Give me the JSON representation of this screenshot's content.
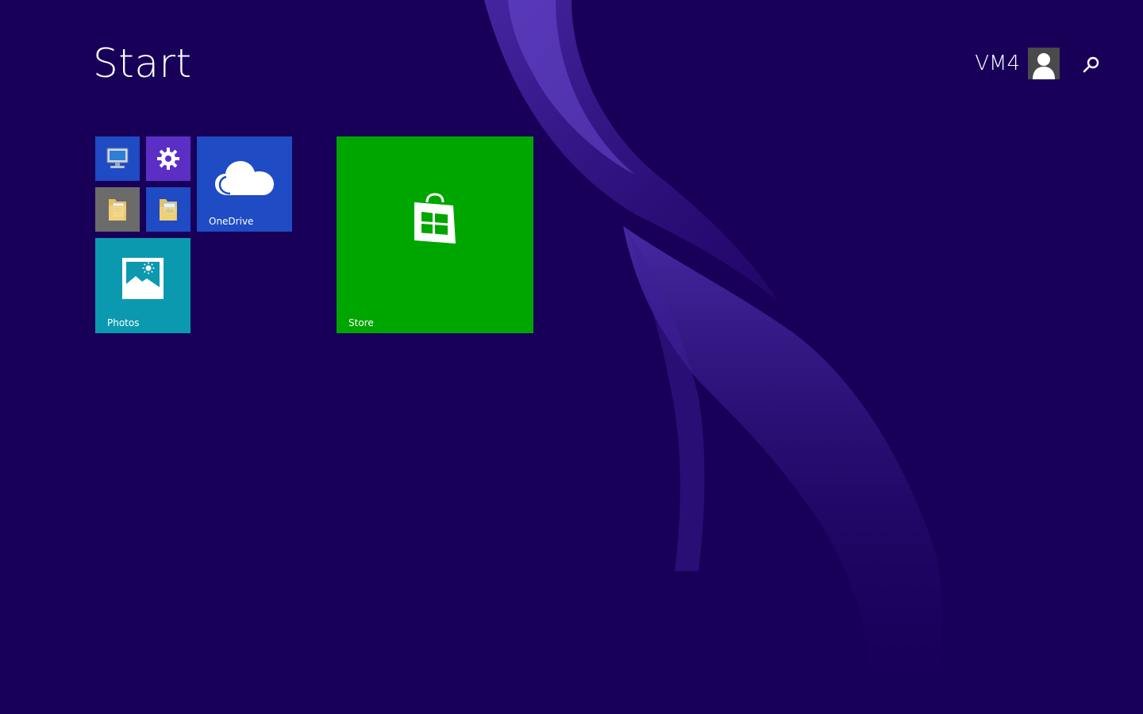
{
  "screen": {
    "title": "Start",
    "background_color": "#180059",
    "accent_swirl_color": "#5a3bb5"
  },
  "user": {
    "name": "VM4",
    "avatar_icon": "user-silhouette-icon"
  },
  "search": {
    "icon": "search-icon"
  },
  "tiles": [
    {
      "id": "this-pc",
      "label": "",
      "icon": "computer-icon",
      "color": "#1f4bc4"
    },
    {
      "id": "pc-settings",
      "label": "",
      "icon": "gear-icon",
      "color": "#5b2fc5"
    },
    {
      "id": "documents",
      "label": "",
      "icon": "documents-folder-icon",
      "color": "#6b6b6b"
    },
    {
      "id": "pictures",
      "label": "",
      "icon": "pictures-folder-icon",
      "color": "#1f4bc4"
    },
    {
      "id": "onedrive",
      "label": "OneDrive",
      "icon": "cloud-icon",
      "color": "#1f4bc4"
    },
    {
      "id": "photos",
      "label": "Photos",
      "icon": "photo-icon",
      "color": "#0b99b0"
    },
    {
      "id": "store",
      "label": "Store",
      "icon": "store-bag-icon",
      "color": "#00a600"
    }
  ]
}
